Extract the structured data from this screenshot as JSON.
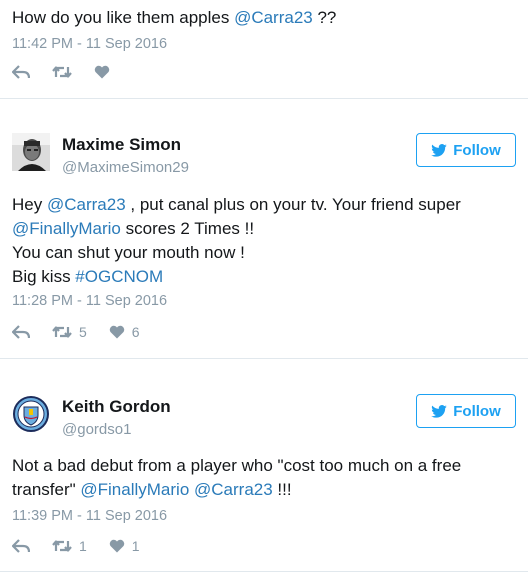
{
  "tweets": [
    {
      "text_parts": [
        {
          "text": "How do you like them apples ",
          "link": false
        },
        {
          "text": "@Carra23",
          "link": true
        },
        {
          "text": " ??",
          "link": false
        }
      ],
      "timestamp": "11:42 PM - 11 Sep 2016",
      "retweets": "",
      "likes": ""
    },
    {
      "author": {
        "name": "Maxime Simon",
        "handle": "@MaximeSimon29",
        "avatar": "person-photo"
      },
      "follow_label": "Follow",
      "lines": [
        [
          {
            "text": "Hey ",
            "link": false
          },
          {
            "text": "@Carra23",
            "link": true
          },
          {
            "text": " , put canal plus on your tv. Your friend super",
            "link": false
          }
        ],
        [
          {
            "text": "@FinallyMario",
            "link": true
          },
          {
            "text": " scores 2 Times !!",
            "link": false
          }
        ],
        [
          {
            "text": "You can shut your mouth now !",
            "link": false
          }
        ],
        [
          {
            "text": "Big kiss ",
            "link": false
          },
          {
            "text": "#OGCNOM",
            "link": true
          }
        ]
      ],
      "timestamp": "11:28 PM - 11 Sep 2016",
      "retweets": "5",
      "likes": "6"
    },
    {
      "author": {
        "name": "Keith Gordon",
        "handle": "@gordso1",
        "avatar": "manchester-city-crest"
      },
      "follow_label": "Follow",
      "lines": [
        [
          {
            "text": "Not a bad debut from a player who \"cost too much on a free",
            "link": false
          }
        ],
        [
          {
            "text": "transfer\" ",
            "link": false
          },
          {
            "text": "@FinallyMario",
            "link": true
          },
          {
            "text": " ",
            "link": false
          },
          {
            "text": "@Carra23",
            "link": true
          },
          {
            "text": " !!!",
            "link": false
          }
        ]
      ],
      "timestamp": "11:39 PM - 11 Sep 2016",
      "retweets": "1",
      "likes": "1"
    }
  ],
  "icons": {
    "reply": "reply-icon",
    "retweet": "retweet-icon",
    "like": "heart-icon",
    "follow": "twitter-bird-icon"
  },
  "colors": {
    "link": "#2b7bb9",
    "muted": "#8899a6",
    "follow_blue": "#1da1f2",
    "divider": "#e1e8ed"
  }
}
